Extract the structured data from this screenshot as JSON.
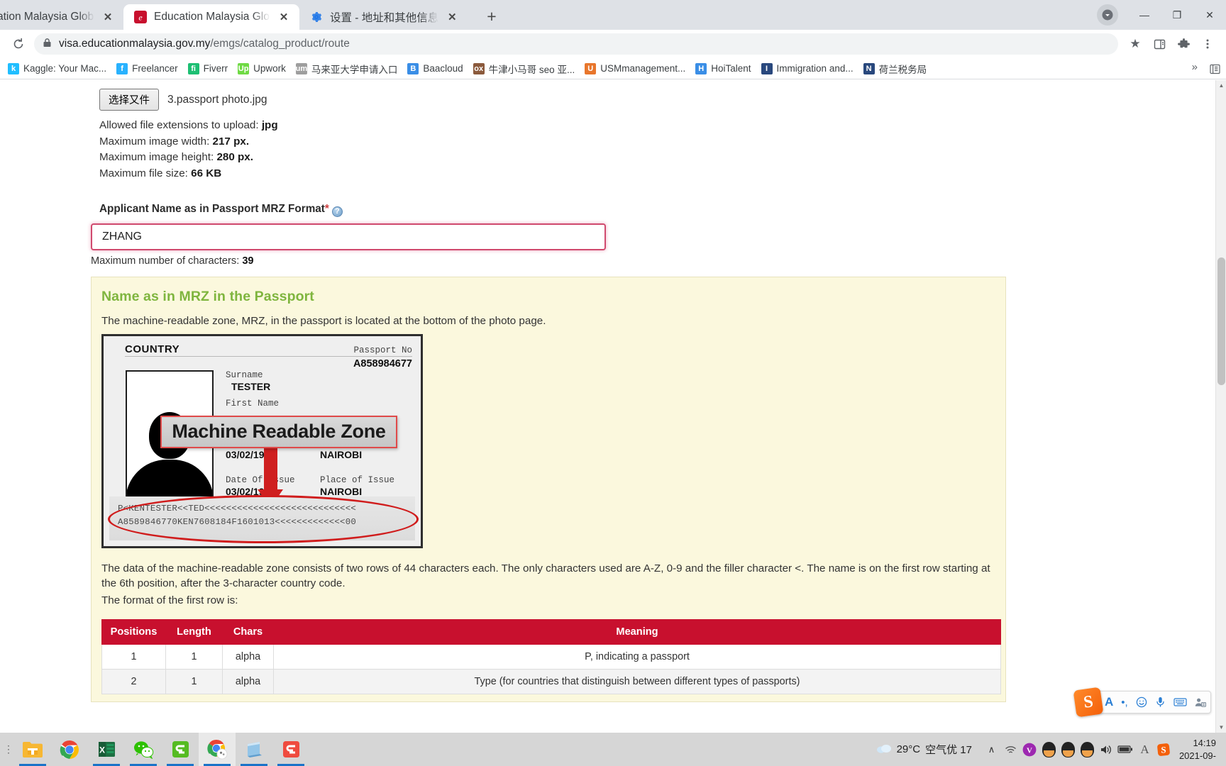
{
  "browser": {
    "tabs": [
      {
        "title": "ation Malaysia Global Ser",
        "favicon": "emgs-icon",
        "active": false
      },
      {
        "title": "Education Malaysia Global Ser",
        "favicon": "emgs-icon",
        "active": true
      },
      {
        "title": "设置 - 地址和其他信息",
        "favicon": "gear-icon",
        "active": false
      }
    ],
    "new_tab_label": "+",
    "window_controls": {
      "minimize": "—",
      "maximize": "❐",
      "close": "✕"
    },
    "reload_label": "⟳",
    "url_host": "visa.educationmalaysia.gov.my",
    "url_path": "/emgs/catalog_product/route",
    "lock_icon": "lock-icon",
    "star_icon": "★",
    "bookmarks": [
      {
        "label": "Kaggle: Your Mac...",
        "icon": "k",
        "color": "#20beff"
      },
      {
        "label": "Freelancer",
        "icon": "f",
        "color": "#29b2fe"
      },
      {
        "label": "Fiverr",
        "icon": "fi",
        "color": "#1dbf73"
      },
      {
        "label": "Upwork",
        "icon": "Up",
        "color": "#6fda44"
      },
      {
        "label": "马来亚大学申请入口",
        "icon": "um",
        "color": "#9e9e9e"
      },
      {
        "label": "Baacloud",
        "icon": "B",
        "color": "#3a8ee6"
      },
      {
        "label": "牛津小马哥 seo 亚...",
        "icon": "ox",
        "color": "#8b5a3c"
      },
      {
        "label": "USMmanagement...",
        "icon": "U",
        "color": "#e8762c"
      },
      {
        "label": "HoiTalent",
        "icon": "H",
        "color": "#3a8ee6"
      },
      {
        "label": "Immigration and...",
        "icon": "I",
        "color": "#29487d"
      },
      {
        "label": "荷兰税务局",
        "icon": "N",
        "color": "#29487d"
      }
    ],
    "bookmarks_overflow": "»",
    "all_bookmarks_icon": "list-icon"
  },
  "page": {
    "file_upload": {
      "button_label": "选择又件",
      "file_name": "3.passport photo.jpg"
    },
    "meta": [
      {
        "label": "Allowed file extensions to upload:",
        "value": "jpg"
      },
      {
        "label": "Maximum image width:",
        "value": "217 px."
      },
      {
        "label": "Maximum image height:",
        "value": "280 px."
      },
      {
        "label": "Maximum file size:",
        "value": "66 KB"
      }
    ],
    "field": {
      "label": "Applicant Name as in Passport MRZ Format",
      "required_mark": "*",
      "help_icon": "help-icon",
      "value": "ZHANG",
      "placeholder": "",
      "char_limit_label": "Maximum number of characters:",
      "char_limit_value": "39"
    },
    "infobox": {
      "title": "Name as in MRZ in the Passport",
      "intro": "The machine-readable zone, MRZ, in the passport is located at the bottom of the photo page.",
      "passport": {
        "country_label": "COUNTRY",
        "passport_no_label": "Passport No",
        "passport_no": "A858984677",
        "surname_label": "Surname",
        "surname": "TESTER",
        "firstname_label": "First Name",
        "dob_value": "03/02/1990",
        "pob_value": "NAIROBI",
        "issue_label": "Date Of Issue",
        "issue_value": "03/02/1990",
        "poi_label": "Place of Issue",
        "poi_value": "NAIROBI",
        "banner_text": "Machine Readable Zone",
        "mrz_line1": "P<KENTESTER<<TED<<<<<<<<<<<<<<<<<<<<<<<<<<<<",
        "mrz_line2": "A8589846770KEN7608184F1601013<<<<<<<<<<<<<00"
      },
      "paragraph": "The data of the machine-readable zone consists of two rows of 44 characters each. The only characters used are A-Z, 0-9 and the filler character <. The name is on the first row starting at the 6th position, after the 3-character country code.",
      "format_line": "The format of the first row is:",
      "table": {
        "headers": [
          "Positions",
          "Length",
          "Chars",
          "Meaning"
        ],
        "rows": [
          [
            "1",
            "1",
            "alpha",
            "P, indicating a passport"
          ],
          [
            "2",
            "1",
            "alpha",
            "Type (for countries that distinguish between different types of passports)"
          ]
        ]
      }
    }
  },
  "ime": {
    "logo": "S",
    "items": [
      "A",
      "•,",
      "☺",
      "🎤",
      "⌨",
      "👤"
    ]
  },
  "taskbar": {
    "apps": [
      {
        "name": "file-explorer",
        "active": false
      },
      {
        "name": "chrome",
        "active": false
      },
      {
        "name": "excel",
        "active": false
      },
      {
        "name": "wechat",
        "active": false
      },
      {
        "name": "wps-green",
        "active": false
      },
      {
        "name": "chrome-beta",
        "active": true
      },
      {
        "name": "notepad",
        "active": false
      },
      {
        "name": "wps-red",
        "active": false
      }
    ],
    "weather_temp": "29°C",
    "weather_text": "空气优 17",
    "tray_chevron": "∧",
    "time": "14:19",
    "date": "2021-09-"
  },
  "colors": {
    "accent_red": "#c8102e",
    "info_bg": "#fbf8dd",
    "title_green": "#7fb53e",
    "input_border": "#d04a6e"
  }
}
